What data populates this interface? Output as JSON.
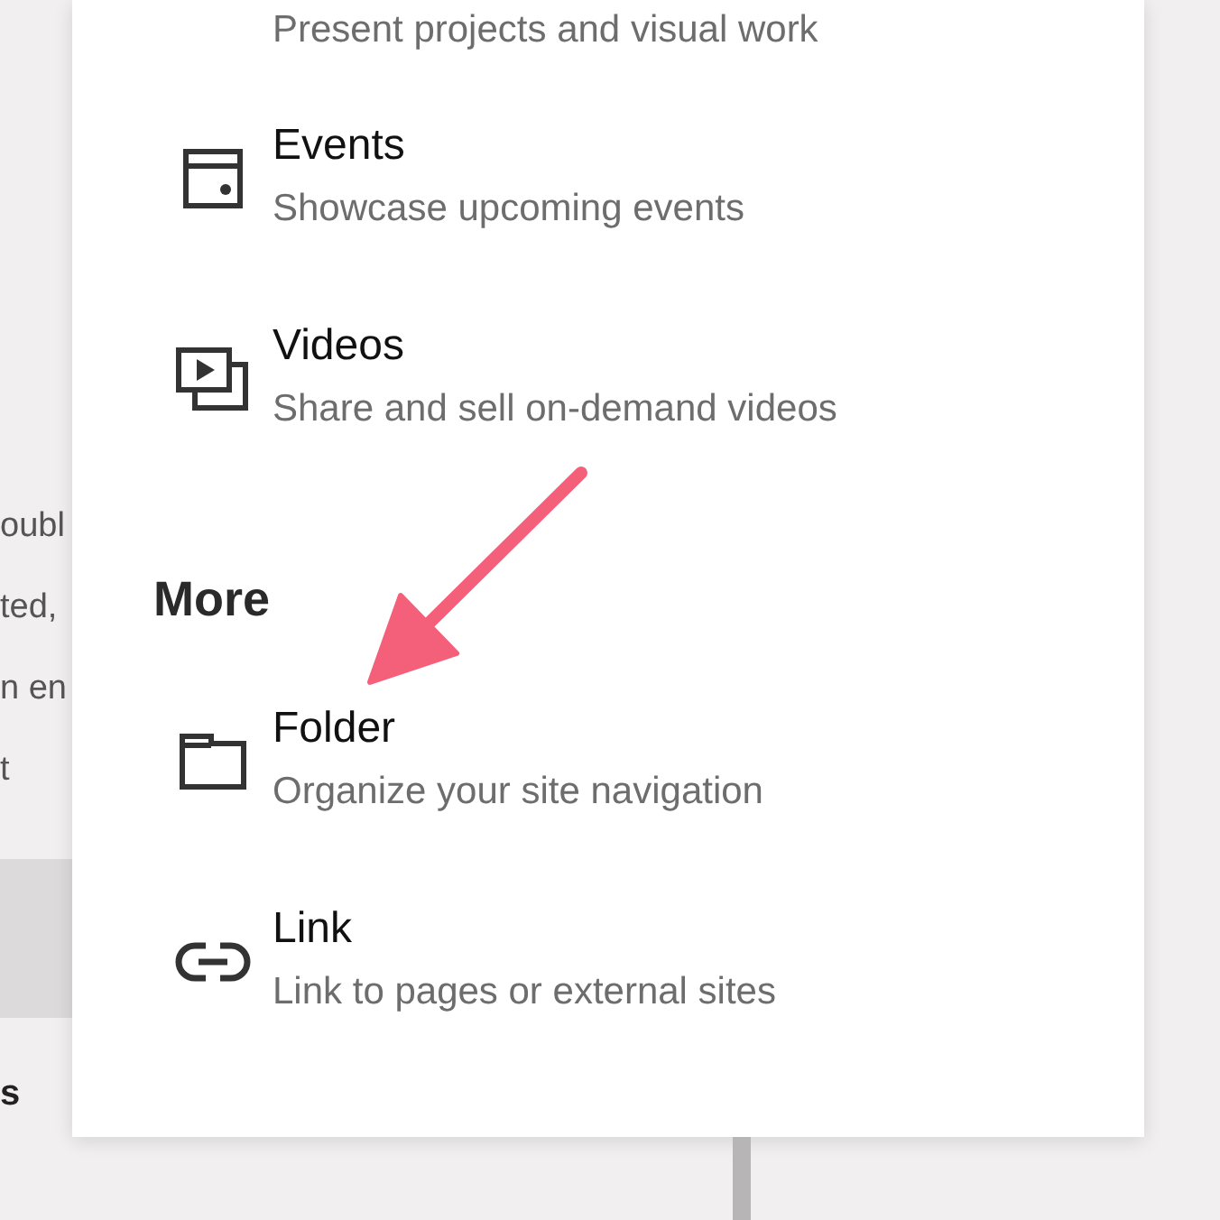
{
  "background_fragments": [
    {
      "text": "oubl",
      "kind": "text"
    },
    {
      "text": "ted,",
      "kind": "text"
    },
    {
      "text": "n en",
      "kind": "text"
    },
    {
      "text": "t",
      "kind": "text"
    },
    {
      "kind": "block"
    },
    {
      "text": "s",
      "kind": "heading"
    }
  ],
  "menu": {
    "sections": [
      {
        "items": [
          {
            "kind": "partial",
            "description": "Present projects and visual work"
          },
          {
            "kind": "events",
            "title": "Events",
            "description": "Showcase upcoming events"
          },
          {
            "kind": "videos",
            "title": "Videos",
            "description": "Share and sell on-demand videos"
          }
        ]
      },
      {
        "heading": "More",
        "items": [
          {
            "kind": "folder",
            "title": "Folder",
            "description": "Organize your site navigation"
          },
          {
            "kind": "link",
            "title": "Link",
            "description": "Link to pages or external sites"
          }
        ]
      }
    ]
  },
  "annotation": {
    "kind": "arrow",
    "color": "#f4607a"
  }
}
